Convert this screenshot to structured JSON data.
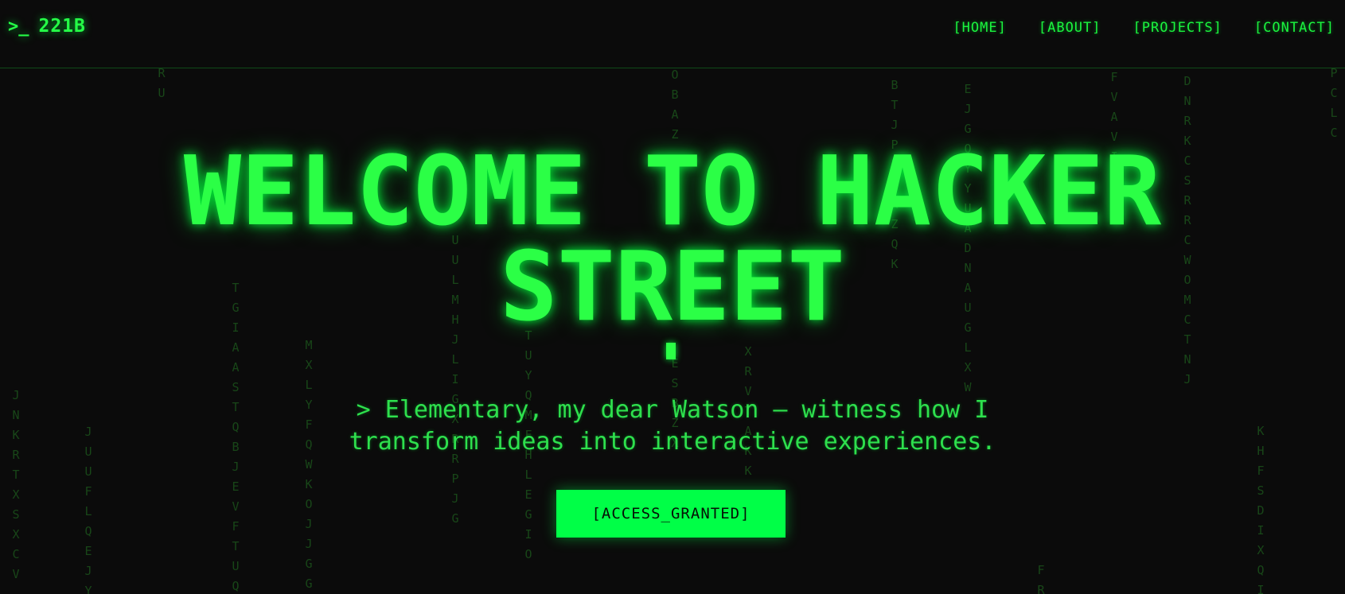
{
  "nav": {
    "logo": {
      "prompt_icon": ">_",
      "text": "221B"
    },
    "links": [
      "[HOME]",
      "[ABOUT]",
      "[PROJECTS]",
      "[CONTACT]"
    ]
  },
  "hero": {
    "title_line1": "WELCOME TO HACKER",
    "title_line2": "STREET",
    "subtitle_line1": "> Elementary, my dear Watson — witness how I",
    "subtitle_line2": "transform ideas into interactive experiences.",
    "cta_label": "[ACCESS_GRANTED]"
  },
  "rain": {
    "columns": [
      "JNKRTXSXCV",
      "JUUFLQEJY",
      "RU",
      "TGIAASTQBJEVFTUQ",
      "MXLYFQWKOJJGG",
      "UULMHJLIGXRRPJG",
      "TUYQMFHLEGIO",
      "OBAZ",
      "ESBZX",
      "XRVTAKK",
      "BTJPIPXZQK",
      "EJGQYYUADNAUGLXW",
      "FR",
      "FVAVI",
      "DNRKCSRRCWOMCTNJ",
      "KHFSDIXQI",
      "PCLC"
    ]
  },
  "colors": {
    "background": "#0b0b0b",
    "accent": "#00ff47",
    "text_green": "#2ee04d",
    "rain_green": "#1d5a1d"
  }
}
